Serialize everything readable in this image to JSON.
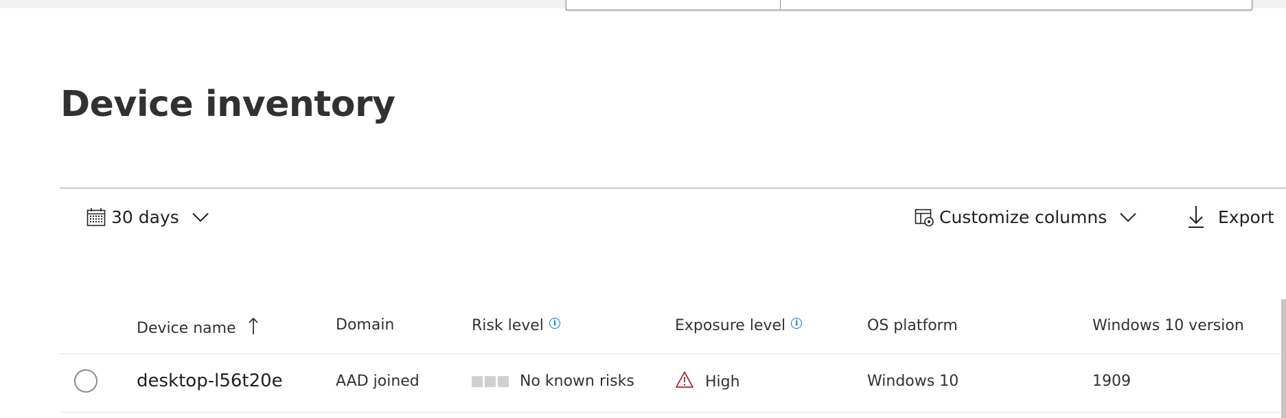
{
  "page": {
    "title": "Device inventory"
  },
  "toolbar": {
    "period_label": "30 days",
    "period_icon": "calendar-icon",
    "customize_label": "Customize columns",
    "customize_icon": "customize-columns-icon",
    "export_label": "Export",
    "export_icon": "download-icon"
  },
  "table": {
    "columns": [
      {
        "label": "Device name",
        "sort": "ascending"
      },
      {
        "label": "Domain"
      },
      {
        "label": "Risk level",
        "info": true
      },
      {
        "label": "Exposure level",
        "info": true
      },
      {
        "label": "OS platform"
      },
      {
        "label": "Windows 10 version"
      }
    ],
    "rows": [
      {
        "device_name": "desktop-l56t20e",
        "domain": "AAD joined",
        "risk_level": "No known risks",
        "exposure_level": "High",
        "os_platform": "Windows 10",
        "windows_version": "1909"
      }
    ]
  },
  "colors": {
    "accent": "#0078d4",
    "warning": "#a4262c",
    "text": "#323130",
    "divider": "#c8c6c4"
  }
}
